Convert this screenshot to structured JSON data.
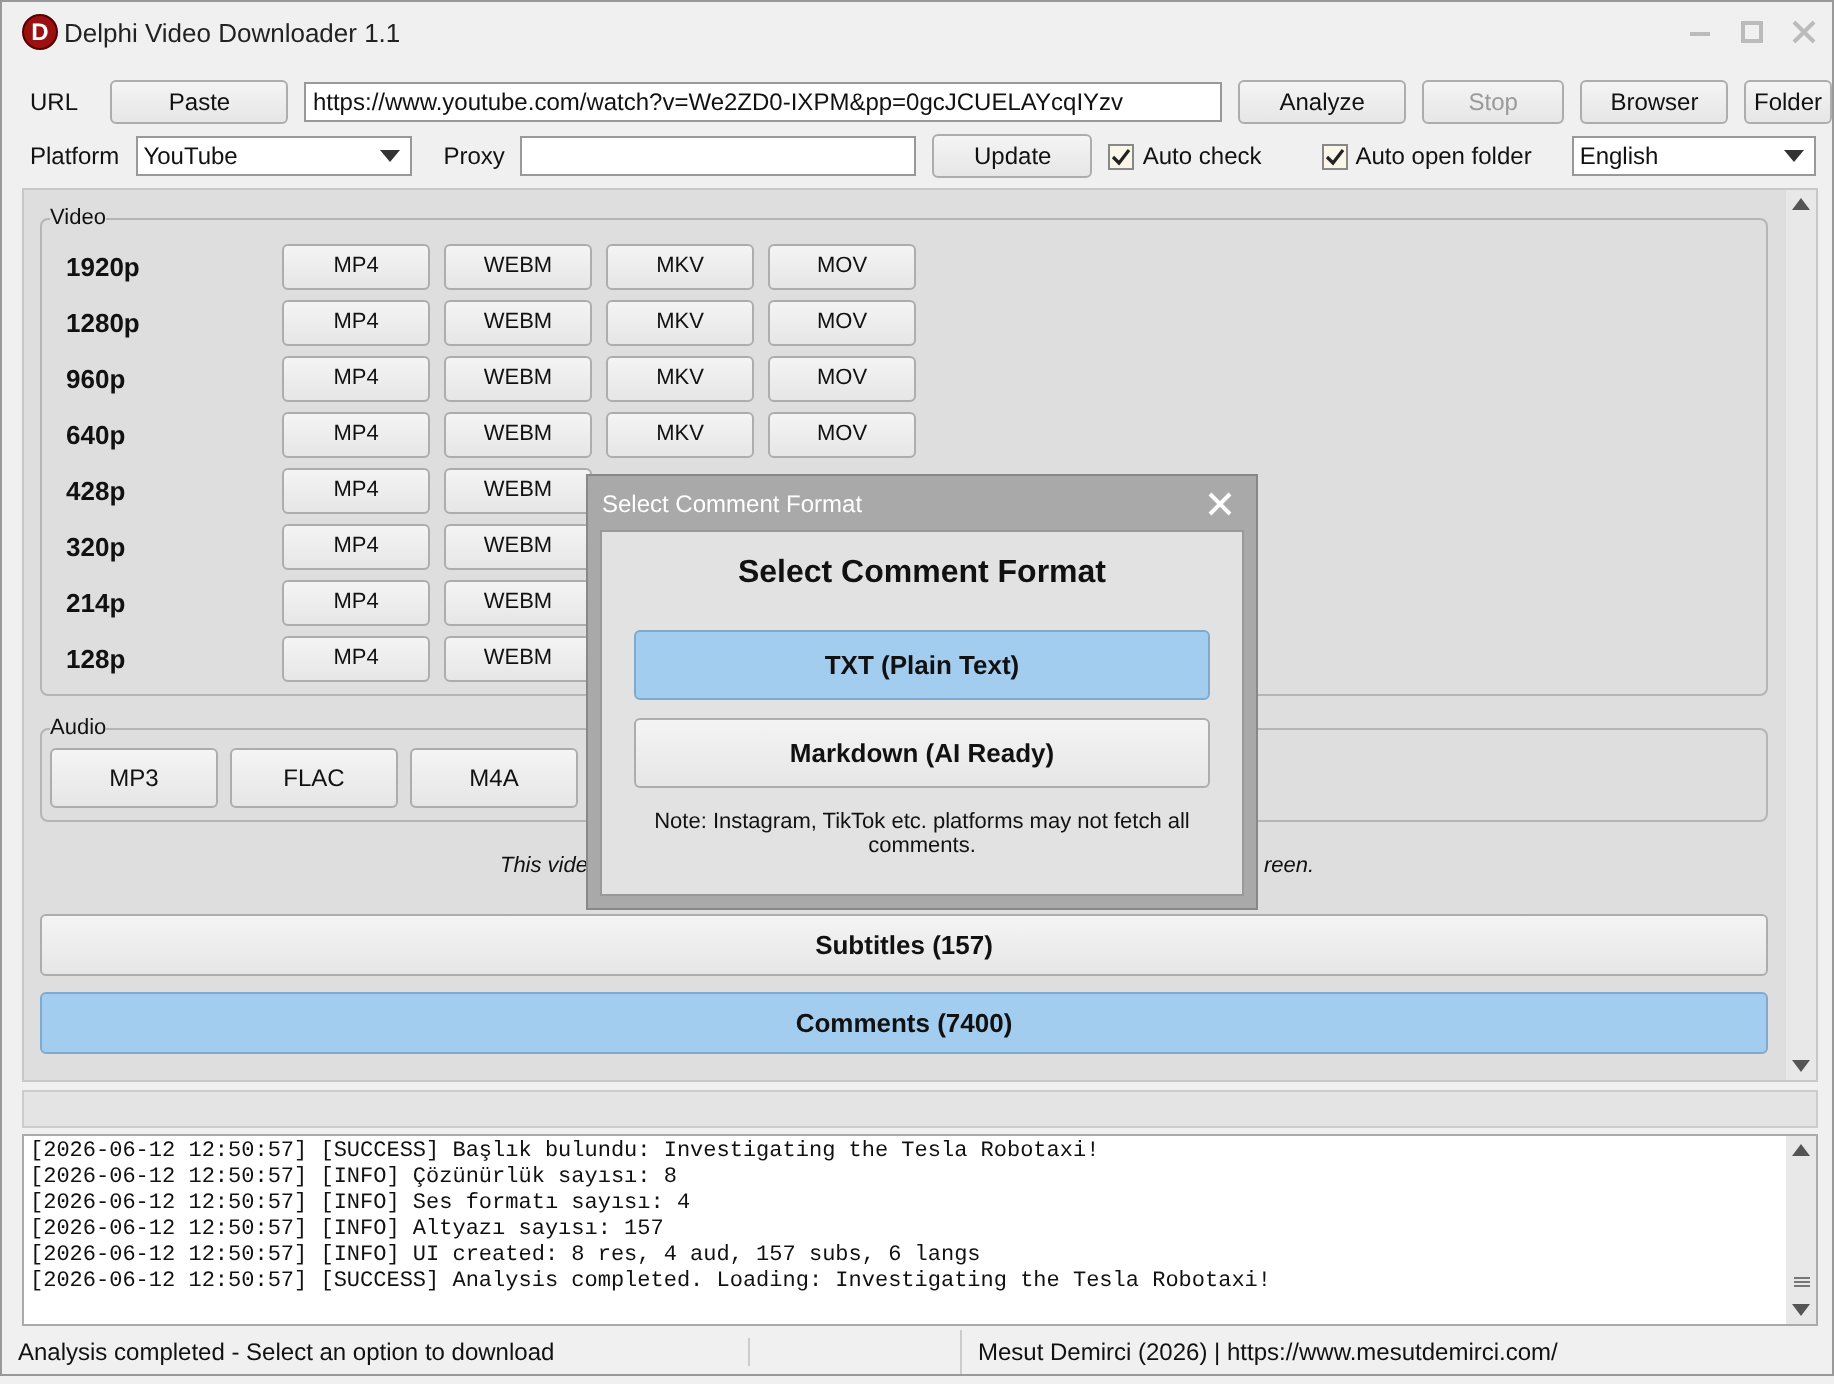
{
  "window": {
    "logo": "D",
    "title": "Delphi Video Downloader 1.1"
  },
  "toolbar": {
    "url_label": "URL",
    "paste": "Paste",
    "url": "https://www.youtube.com/watch?v=We2ZD0-IXPM&pp=0gcJCUELAYcqIYzv",
    "analyze": "Analyze",
    "stop": {
      "label": "Stop",
      "disabled": true
    },
    "browser": "Browser",
    "folder": "Folder",
    "platform_label": "Platform",
    "platform": "YouTube",
    "proxy_label": "Proxy",
    "update": "Update",
    "auto_check": {
      "label": "Auto check",
      "checked": true
    },
    "auto_open_folder": {
      "label": "Auto open folder",
      "checked": true
    },
    "language": "English"
  },
  "video": {
    "title": "Video",
    "rows": [
      {
        "resolution": "1920p",
        "formats": [
          "MP4",
          "WEBM",
          "MKV",
          "MOV"
        ]
      },
      {
        "resolution": "1280p",
        "formats": [
          "MP4",
          "WEBM",
          "MKV",
          "MOV"
        ]
      },
      {
        "resolution": "960p",
        "formats": [
          "MP4",
          "WEBM",
          "MKV",
          "MOV"
        ]
      },
      {
        "resolution": "640p",
        "formats": [
          "MP4",
          "WEBM",
          "MKV",
          "MOV"
        ]
      },
      {
        "resolution": "428p",
        "formats": [
          "MP4",
          "WEBM"
        ]
      },
      {
        "resolution": "320p",
        "formats": [
          "MP4",
          "WEBM"
        ]
      },
      {
        "resolution": "214p",
        "formats": [
          "MP4",
          "WEBM"
        ]
      },
      {
        "resolution": "128p",
        "formats": [
          "MP4",
          "WEBM"
        ]
      }
    ]
  },
  "audio": {
    "title": "Audio",
    "formats": [
      "MP3",
      "FLAC",
      "M4A"
    ]
  },
  "note": {
    "left": "This vide",
    "right": "reen."
  },
  "sections": [
    {
      "label": "Subtitles (157)",
      "selected": false
    },
    {
      "label": "Comments (7400)",
      "selected": true
    }
  ],
  "log": [
    "[2026-06-12 12:50:57] [SUCCESS] Başlık bulundu: Investigating the Tesla Robotaxi!",
    "[2026-06-12 12:50:57] [INFO] Çözünürlük sayısı: 8",
    "[2026-06-12 12:50:57] [INFO] Ses formatı sayısı: 4",
    "[2026-06-12 12:50:57] [INFO] Altyazı sayısı: 157",
    "[2026-06-12 12:50:57] [INFO] UI created: 8 res, 4 aud, 157 subs, 6 langs",
    "[2026-06-12 12:50:57] [SUCCESS] Analysis completed. Loading: Investigating the Tesla Robotaxi!"
  ],
  "status_bar": {
    "message": "Analysis completed - Select an option to download",
    "credit": "Mesut Demirci (2026) | https://www.mesutdemirci.com/"
  },
  "dialog": {
    "title": "Select Comment Format",
    "heading": "Select Comment Format",
    "options": [
      {
        "label": "TXT (Plain Text)",
        "selected": true
      },
      {
        "label": "Markdown (AI Ready)",
        "selected": false
      }
    ],
    "note": "Note: Instagram, TikTok etc. platforms may not fetch all comments."
  }
}
